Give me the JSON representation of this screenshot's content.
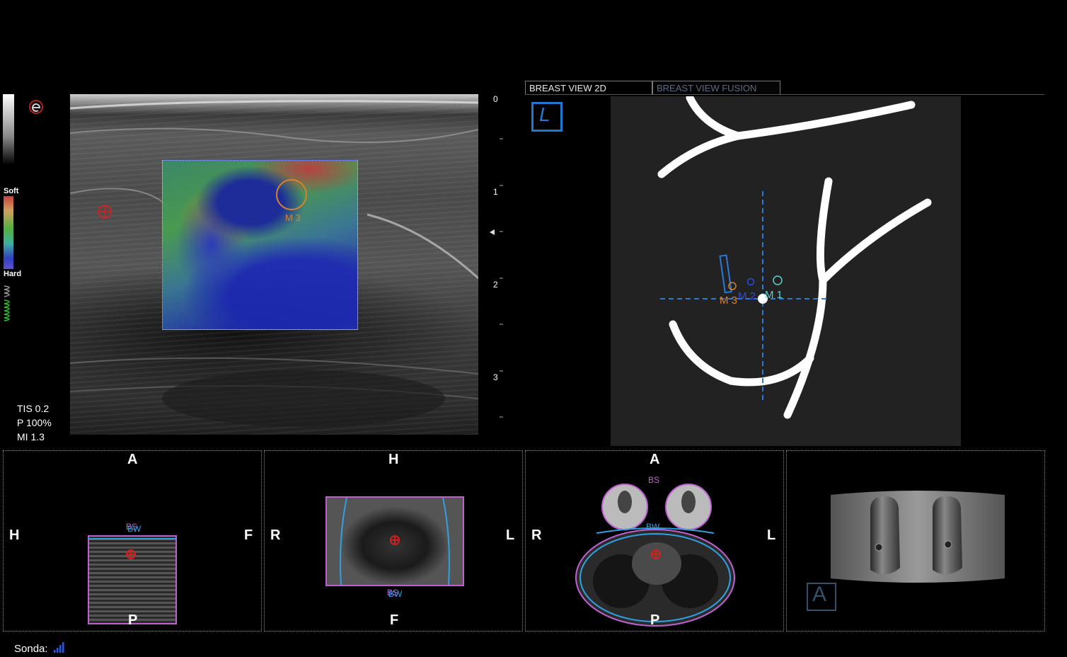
{
  "left_bar": {
    "soft_label": "Soft",
    "hard_label": "Hard",
    "elasto_logo": "elastography-e-icon"
  },
  "depth_scale": {
    "ticks": [
      "0",
      "1",
      "2",
      "3"
    ]
  },
  "acoustic": {
    "tis": "TIS 0.2",
    "power": "P 100%",
    "mi": "MI 1.3"
  },
  "ultrasound": {
    "marker_label": "M 3"
  },
  "tabs": {
    "tab1": "BREAST VIEW 2D",
    "tab2": "BREAST VIEW FUSION"
  },
  "breast_view": {
    "side_label": "L",
    "markers": {
      "m3": "M 3",
      "m2": "M 2",
      "m1": "M 1"
    },
    "colors": {
      "m3": "#d9822b",
      "m2": "#2a4ee0",
      "m1": "#5fd0d0",
      "crosshair": "#2a7ad9"
    }
  },
  "mri_sagittal": {
    "top": "A",
    "bottom": "P",
    "left": "H",
    "right": "F",
    "bs": "BS",
    "bw": "BW"
  },
  "mri_coronal": {
    "top": "H",
    "bottom": "F",
    "left": "R",
    "right": "L",
    "bs": "BS",
    "bw": "BW"
  },
  "mri_axial": {
    "top": "A",
    "bottom": "P",
    "left": "R",
    "right": "L",
    "bs": "BS",
    "bw": "BW"
  },
  "volume3d": {
    "orient_label": "A"
  },
  "footer": {
    "probe_label": "Sonda:",
    "probe_icon": "signal-bars-icon"
  }
}
